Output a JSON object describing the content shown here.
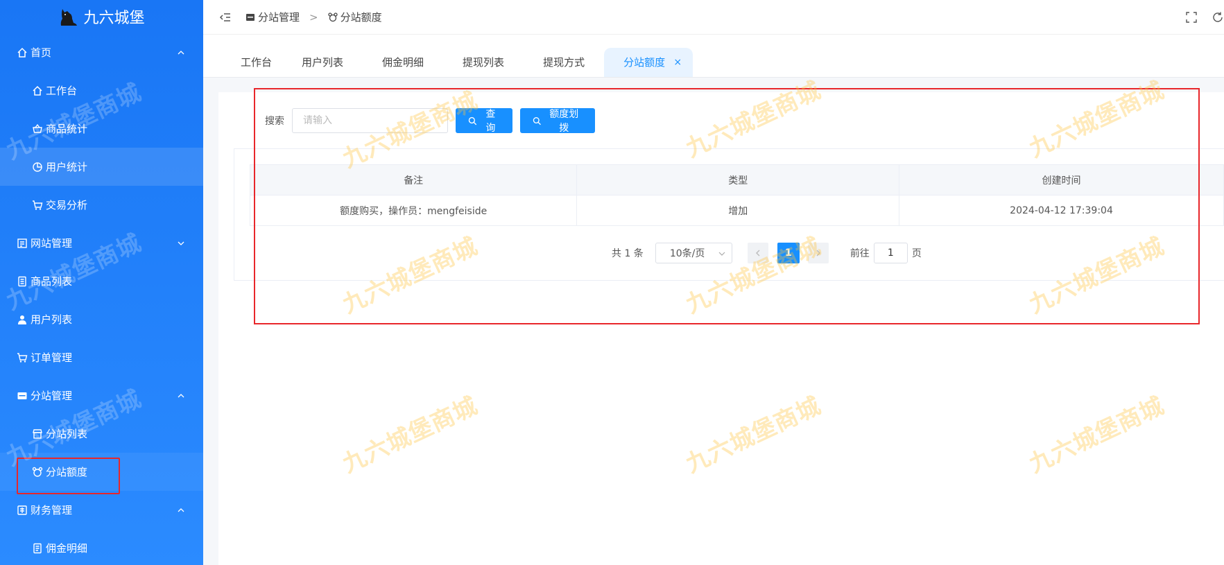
{
  "app": {
    "title": "九六城堡"
  },
  "sidebar": {
    "menu": [
      {
        "label": "首页",
        "level": 1,
        "icon": "home-icon",
        "expanded": true
      },
      {
        "label": "工作台",
        "level": 2,
        "icon": "home-icon"
      },
      {
        "label": "商品统计",
        "level": 2,
        "icon": "basket-icon"
      },
      {
        "label": "用户统计",
        "level": 2,
        "icon": "pie-icon",
        "selected": true
      },
      {
        "label": "交易分析",
        "level": 2,
        "icon": "cart-icon"
      },
      {
        "label": "网站管理",
        "level": 1,
        "icon": "site-icon",
        "expanded": false
      },
      {
        "label": "商品列表",
        "level": 1,
        "icon": "list-icon"
      },
      {
        "label": "用户列表",
        "level": 1,
        "icon": "user-icon"
      },
      {
        "label": "订单管理",
        "level": 1,
        "icon": "cart-icon"
      },
      {
        "label": "分站管理",
        "level": 1,
        "icon": "station-icon",
        "expanded": true
      },
      {
        "label": "分站列表",
        "level": 2,
        "icon": "shop-icon"
      },
      {
        "label": "分站额度",
        "level": 2,
        "icon": "bear-icon",
        "active": true
      },
      {
        "label": "财务管理",
        "level": 1,
        "icon": "finance-icon",
        "expanded": true
      },
      {
        "label": "佣金明细",
        "level": 2,
        "icon": "doc-icon"
      }
    ]
  },
  "breadcrumb": {
    "items": [
      {
        "label": "分站管理"
      },
      {
        "label": "分站额度"
      }
    ],
    "separator": ">"
  },
  "tabs": [
    {
      "label": "工作台"
    },
    {
      "label": "用户列表"
    },
    {
      "label": "佣金明细"
    },
    {
      "label": "提现列表"
    },
    {
      "label": "提现方式"
    },
    {
      "label": "分站额度",
      "active": true
    }
  ],
  "tab_close": "×",
  "search": {
    "label": "搜索",
    "placeholder": "请输入",
    "query_button": "查询",
    "allocate_button": "额度划拨"
  },
  "table": {
    "columns": [
      "备注",
      "类型",
      "创建时间"
    ],
    "rows": [
      [
        "额度购买，操作员：mengfeiside",
        "增加",
        "2024-04-12 17:39:04"
      ]
    ]
  },
  "pagination": {
    "total_text": "共 1 条",
    "page_size": "10条/页",
    "current_page": "1",
    "goto_prefix": "前往",
    "goto_value": "1",
    "goto_suffix": "页"
  },
  "watermark": {
    "text": "九六城堡商城"
  },
  "colors": {
    "primary": "#1890ff",
    "sidebar": "#1976f5",
    "highlight": "#e8262a"
  }
}
